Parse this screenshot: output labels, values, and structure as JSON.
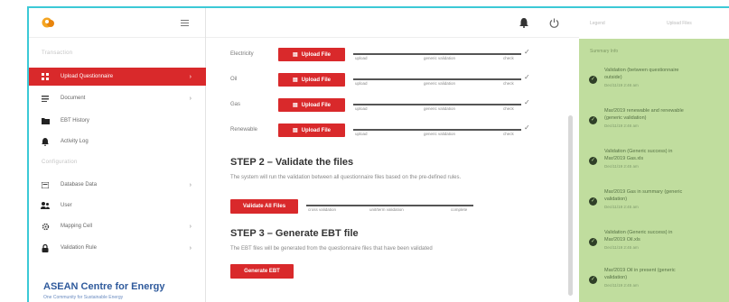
{
  "sidebar": {
    "section_main": "Transaction",
    "items": [
      {
        "label": "Upload Questionnaire",
        "icon": "grid-icon",
        "chevron": "›",
        "active": true
      },
      {
        "label": "Document",
        "icon": "document-icon",
        "chevron": "›",
        "active": false
      },
      {
        "label": "EBT History",
        "icon": "folder-icon",
        "chevron": "",
        "active": false
      },
      {
        "label": "Activity Log",
        "icon": "bell-icon",
        "chevron": "",
        "active": false
      }
    ],
    "section_config": "Configuration",
    "config_items": [
      {
        "label": "Database Data",
        "icon": "database-icon",
        "chevron": "›"
      },
      {
        "label": "User",
        "icon": "users-icon",
        "chevron": ""
      },
      {
        "label": "Mapping Cell",
        "icon": "gear-icon",
        "chevron": "›"
      },
      {
        "label": "Validation Rule",
        "icon": "lock-icon",
        "chevron": "›"
      }
    ],
    "brand_name": "ASEAN Centre for Energy",
    "brand_sub": "One Community for Sustainable Energy"
  },
  "uploads": {
    "button_label": "Upload File",
    "rows": [
      {
        "label": "Electricity",
        "s1": "upload",
        "s2": "generic validation",
        "s3": "check"
      },
      {
        "label": "Oil",
        "s1": "upload",
        "s2": "generic validation",
        "s3": "check"
      },
      {
        "label": "Gas",
        "s1": "upload",
        "s2": "generic validation",
        "s3": "check"
      },
      {
        "label": "Renewable",
        "s1": "upload",
        "s2": "generic validation",
        "s3": "check"
      }
    ],
    "check_glyph": "✓"
  },
  "step2": {
    "title": "STEP 2 – Validate the files",
    "desc": "The system will run the validation between all questionnaire files based on the pre-defined rules.",
    "button_label": "Validate All Files",
    "prog_s1": "cross validation",
    "prog_s2": "unit/term validation",
    "prog_s3": "complete"
  },
  "step3": {
    "title": "STEP 3 – Generate EBT file",
    "desc": "The EBT files will be generated from the questionnaire files that have been validated",
    "button_label": "Generate EBT"
  },
  "right_header": {
    "h1": "Legend",
    "h2": "Upload Files"
  },
  "notifications": {
    "title": "Summary Info",
    "items": [
      {
        "l1": "Validation (between questionnaire",
        "l2": "outside)",
        "date": "Dec/11/19 2:46 am"
      },
      {
        "l1": "Mar/2019 renewable and renewable",
        "l2": "(generic validation)",
        "date": "Dec/11/19 2:46 am"
      },
      {
        "l1": "Validation (Generic success) in",
        "l2": "Mar/2019 Gas.xls",
        "date": "Dec/11/19 2:45 am"
      },
      {
        "l1": "Mar/2019 Gas in summary (generic",
        "l2": "validation)",
        "date": "Dec/11/19 2:45 am"
      },
      {
        "l1": "Validation (Generic success) in",
        "l2": "Mar/2019 Oil.xls",
        "date": "Dec/11/19 2:45 am"
      },
      {
        "l1": "Mar/2019 Oil in present (generic",
        "l2": "validation)",
        "date": "Dec/11/19 2:45 am"
      }
    ]
  },
  "colors": {
    "accent": "#d9292b",
    "frame": "#3cc9d6",
    "panel": "#c0dd9e",
    "brand": "#2f5a9c"
  }
}
